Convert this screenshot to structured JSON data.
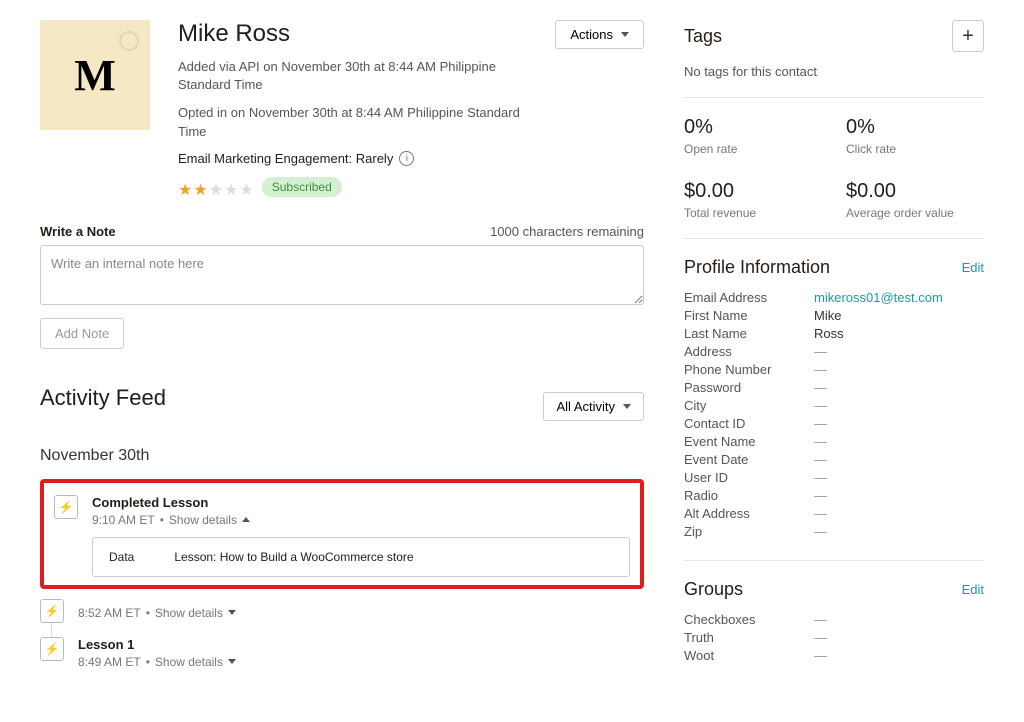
{
  "contact": {
    "name": "Mike Ross",
    "avatar_letter": "M",
    "added_text": "Added via API on November 30th at 8:44 AM Philippine Standard Time",
    "opted_text": "Opted in on November 30th at 8:44 AM Philippine Standard Time",
    "engagement_label": "Email Marketing Engagement: Rarely",
    "stars_filled": 2,
    "stars_total": 5,
    "subscribed_badge": "Subscribed",
    "actions_label": "Actions"
  },
  "note": {
    "title": "Write a Note",
    "chars_remaining": "1000 characters remaining",
    "placeholder": "Write an internal note here",
    "add_btn": "Add Note"
  },
  "activity": {
    "title": "Activity Feed",
    "filter_label": "All Activity",
    "date_group": "November 30th",
    "items": [
      {
        "title": "Completed Lesson",
        "time": "9:10 AM ET",
        "show_details": "Show details",
        "expanded": true,
        "detail_key": "Data",
        "detail_value": "Lesson: How to Build a WooCommerce store"
      },
      {
        "title": "",
        "time": "8:52 AM ET",
        "show_details": "Show details",
        "expanded": false
      },
      {
        "title": "Lesson 1",
        "time": "8:49 AM ET",
        "show_details": "Show details",
        "expanded": false
      }
    ]
  },
  "tags": {
    "title": "Tags",
    "none_text": "No tags for this contact"
  },
  "stats": [
    {
      "value": "0%",
      "label": "Open rate"
    },
    {
      "value": "0%",
      "label": "Click rate"
    },
    {
      "value": "$0.00",
      "label": "Total revenue"
    },
    {
      "value": "$0.00",
      "label": "Average order value"
    }
  ],
  "profile": {
    "title": "Profile Information",
    "edit_label": "Edit",
    "fields": [
      {
        "key": "Email Address",
        "value": "mikeross01@test.com",
        "link": true
      },
      {
        "key": "First Name",
        "value": "Mike"
      },
      {
        "key": "Last Name",
        "value": "Ross"
      },
      {
        "key": "Address",
        "value": "—",
        "empty": true
      },
      {
        "key": "Phone Number",
        "value": "—",
        "empty": true
      },
      {
        "key": "Password",
        "value": "—",
        "empty": true
      },
      {
        "key": "City",
        "value": "—",
        "empty": true
      },
      {
        "key": "Contact ID",
        "value": "—",
        "empty": true
      },
      {
        "key": "Event Name",
        "value": "—",
        "empty": true
      },
      {
        "key": "Event Date",
        "value": "—",
        "empty": true
      },
      {
        "key": "User ID",
        "value": "—",
        "empty": true
      },
      {
        "key": "Radio",
        "value": "—",
        "empty": true
      },
      {
        "key": "Alt Address",
        "value": "—",
        "empty": true
      },
      {
        "key": "Zip",
        "value": "—",
        "empty": true
      }
    ]
  },
  "groups": {
    "title": "Groups",
    "edit_label": "Edit",
    "fields": [
      {
        "key": "Checkboxes",
        "value": "—",
        "empty": true
      },
      {
        "key": "Truth",
        "value": "—",
        "empty": true
      },
      {
        "key": "Woot",
        "value": "—",
        "empty": true
      }
    ]
  }
}
